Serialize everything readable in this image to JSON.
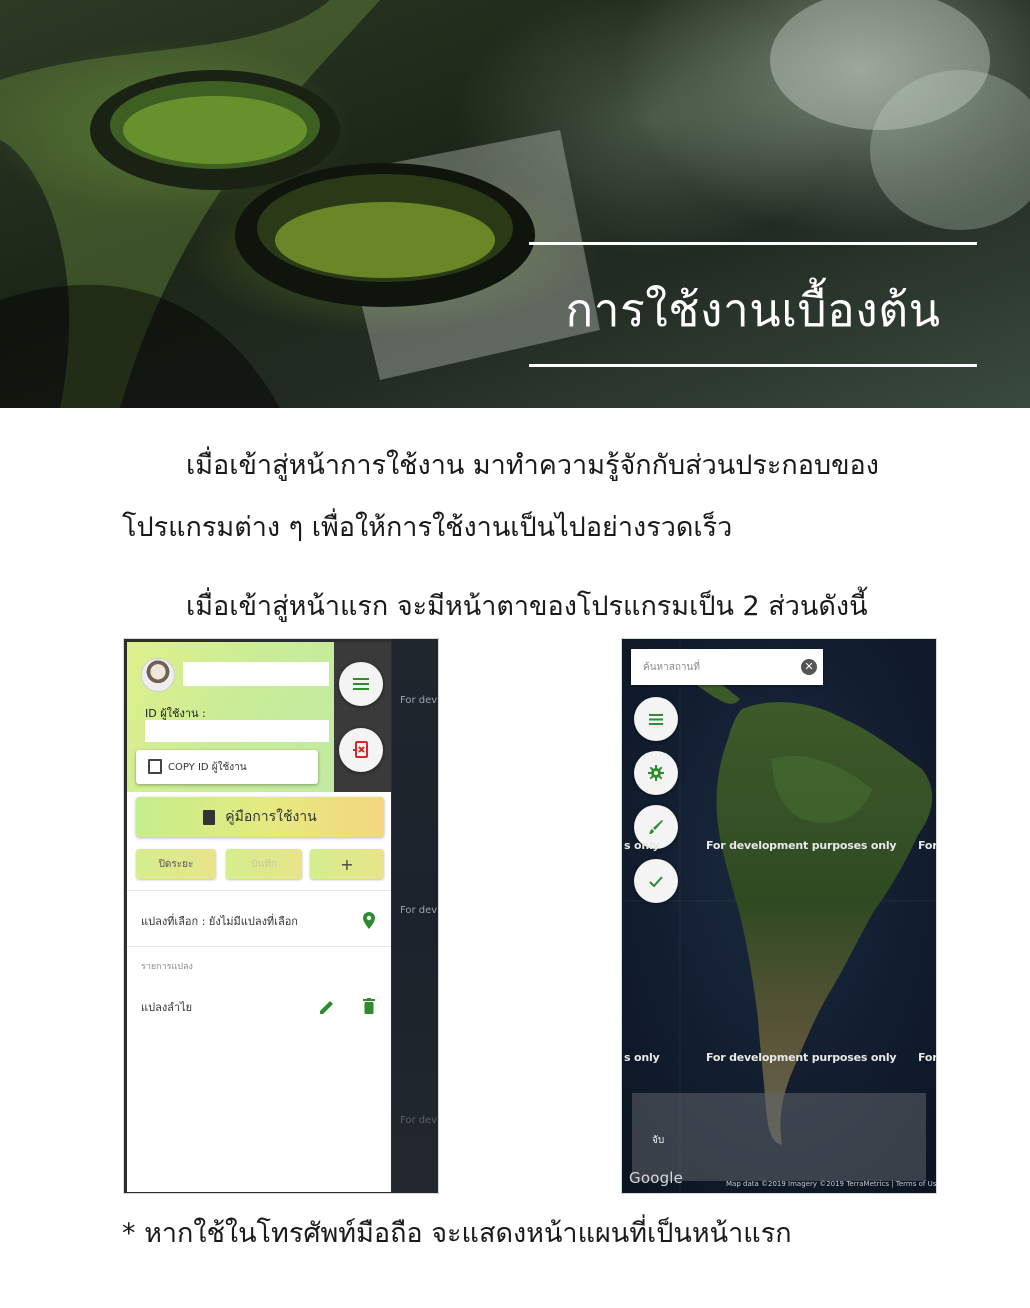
{
  "banner": {
    "title": "การใช้งานเบื้องต้น"
  },
  "intro": {
    "line1": "เมื่อเข้าสู่หน้าการใช้งาน มาทำความรู้จักกับส่วนประกอบของ",
    "line2": "โปรแกรมต่าง ๆ เพื่อให้การใช้งานเป็นไปอย่างรวดเร็ว",
    "line3": "เมื่อเข้าสู่หน้าแรก จะมีหน้าตาของโปรแกรมเป็น 2 ส่วนดังนี้"
  },
  "left_screen": {
    "user_id_label": "ID ผู้ใช้งาน :",
    "copy_id_button": "COPY ID ผู้ใช้งาน",
    "manual_button": "คู่มือการใช้งาน",
    "close_button": "ปิดระยะ",
    "save_button": "บันทึก",
    "add_button": "+",
    "selected_plot": "แปลงที่เลือก : ยังไม่มีแปลงที่เลือก",
    "plot_list_heading": "รายการแปลง",
    "plot_item": "แปลงลำไย",
    "map_watermark": "For dev",
    "icons": {
      "menu": "menu-icon",
      "exit": "exit-icon",
      "location": "location-pin-icon",
      "edit": "edit-icon",
      "delete": "delete-icon"
    }
  },
  "right_screen": {
    "search_placeholder": "ค้นหาสถานที่",
    "watermark_row1_left": "s only",
    "watermark_center": "For development purposes only",
    "watermark_right": "For",
    "watermark_row2_left": "s only",
    "legend_text": "จับ",
    "google_logo": "Google",
    "attribution": "Map data ©2019 Imagery ©2019 TerraMetrics | Terms of Use",
    "icons": {
      "menu": "menu-icon",
      "settings": "gear-icon",
      "draw": "brush-icon",
      "confirm": "check-icon",
      "clear": "close-icon"
    }
  },
  "footnote": "* หากใช้ในโทรศัพท์มือถือ จะแสดงหน้าแผนที่เป็นหน้าแรก",
  "colors": {
    "accent_green": "#2e8b2e",
    "panel_gradient_start": "#dff08a",
    "panel_gradient_end": "#bfe9a5"
  }
}
